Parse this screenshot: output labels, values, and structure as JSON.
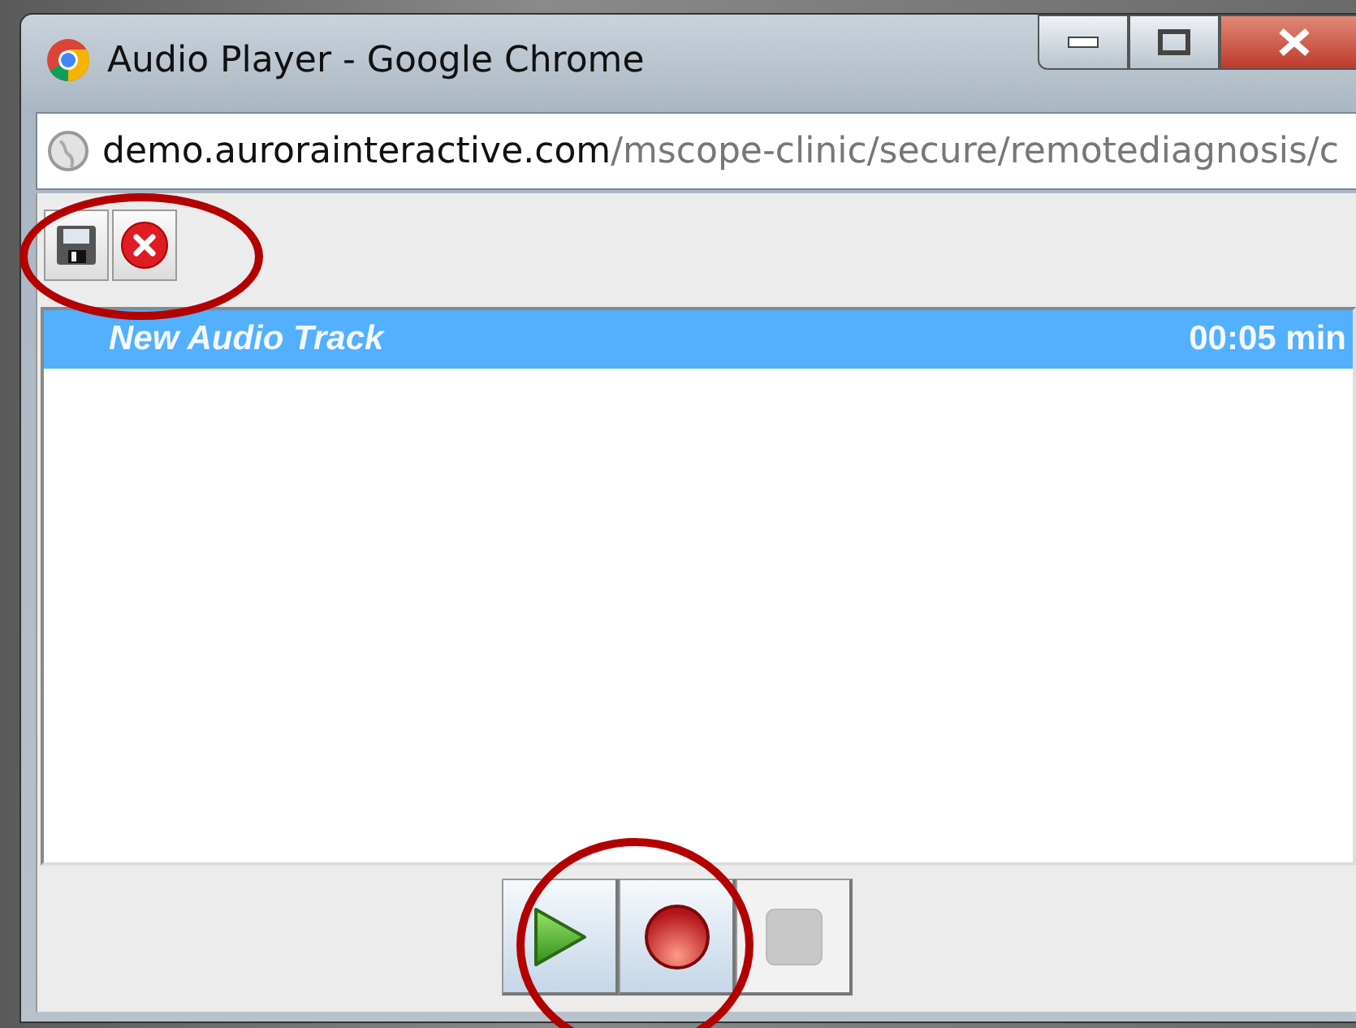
{
  "window": {
    "title": "Audio Player - Google Chrome"
  },
  "address": {
    "host": "demo.aurorainteractive.com",
    "path": "/mscope-clinic/secure/remotediagnosis/c"
  },
  "toolbar": {
    "highlighted": true,
    "buttons": [
      {
        "kind": "save"
      },
      {
        "kind": "delete"
      }
    ]
  },
  "tracks": [
    {
      "name": "New Audio Track",
      "duration": "00:05 min",
      "selected": true
    }
  ],
  "transport": {
    "highlighted": true,
    "buttons": [
      {
        "kind": "play",
        "disabled": false
      },
      {
        "kind": "record",
        "disabled": false
      },
      {
        "kind": "stop",
        "disabled": true
      }
    ]
  }
}
